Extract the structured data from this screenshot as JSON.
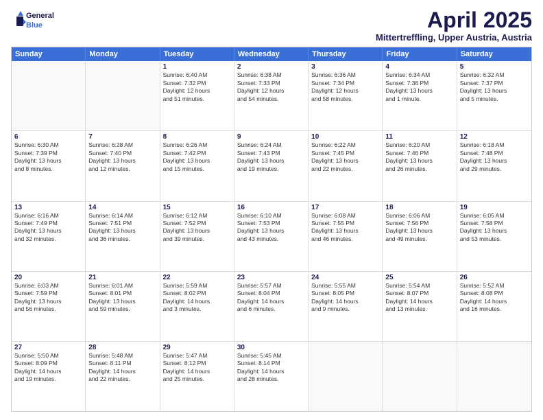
{
  "logo": {
    "line1": "General",
    "line2": "Blue"
  },
  "title": "April 2025",
  "subtitle": "Mittertreffling, Upper Austria, Austria",
  "headers": [
    "Sunday",
    "Monday",
    "Tuesday",
    "Wednesday",
    "Thursday",
    "Friday",
    "Saturday"
  ],
  "weeks": [
    [
      {
        "day": "",
        "info": ""
      },
      {
        "day": "",
        "info": ""
      },
      {
        "day": "1",
        "info": "Sunrise: 6:40 AM\nSunset: 7:32 PM\nDaylight: 12 hours\nand 51 minutes."
      },
      {
        "day": "2",
        "info": "Sunrise: 6:38 AM\nSunset: 7:33 PM\nDaylight: 12 hours\nand 54 minutes."
      },
      {
        "day": "3",
        "info": "Sunrise: 6:36 AM\nSunset: 7:34 PM\nDaylight: 12 hours\nand 58 minutes."
      },
      {
        "day": "4",
        "info": "Sunrise: 6:34 AM\nSunset: 7:36 PM\nDaylight: 13 hours\nand 1 minute."
      },
      {
        "day": "5",
        "info": "Sunrise: 6:32 AM\nSunset: 7:37 PM\nDaylight: 13 hours\nand 5 minutes."
      }
    ],
    [
      {
        "day": "6",
        "info": "Sunrise: 6:30 AM\nSunset: 7:39 PM\nDaylight: 13 hours\nand 8 minutes."
      },
      {
        "day": "7",
        "info": "Sunrise: 6:28 AM\nSunset: 7:40 PM\nDaylight: 13 hours\nand 12 minutes."
      },
      {
        "day": "8",
        "info": "Sunrise: 6:26 AM\nSunset: 7:42 PM\nDaylight: 13 hours\nand 15 minutes."
      },
      {
        "day": "9",
        "info": "Sunrise: 6:24 AM\nSunset: 7:43 PM\nDaylight: 13 hours\nand 19 minutes."
      },
      {
        "day": "10",
        "info": "Sunrise: 6:22 AM\nSunset: 7:45 PM\nDaylight: 13 hours\nand 22 minutes."
      },
      {
        "day": "11",
        "info": "Sunrise: 6:20 AM\nSunset: 7:46 PM\nDaylight: 13 hours\nand 26 minutes."
      },
      {
        "day": "12",
        "info": "Sunrise: 6:18 AM\nSunset: 7:48 PM\nDaylight: 13 hours\nand 29 minutes."
      }
    ],
    [
      {
        "day": "13",
        "info": "Sunrise: 6:16 AM\nSunset: 7:49 PM\nDaylight: 13 hours\nand 32 minutes."
      },
      {
        "day": "14",
        "info": "Sunrise: 6:14 AM\nSunset: 7:51 PM\nDaylight: 13 hours\nand 36 minutes."
      },
      {
        "day": "15",
        "info": "Sunrise: 6:12 AM\nSunset: 7:52 PM\nDaylight: 13 hours\nand 39 minutes."
      },
      {
        "day": "16",
        "info": "Sunrise: 6:10 AM\nSunset: 7:53 PM\nDaylight: 13 hours\nand 43 minutes."
      },
      {
        "day": "17",
        "info": "Sunrise: 6:08 AM\nSunset: 7:55 PM\nDaylight: 13 hours\nand 46 minutes."
      },
      {
        "day": "18",
        "info": "Sunrise: 6:06 AM\nSunset: 7:56 PM\nDaylight: 13 hours\nand 49 minutes."
      },
      {
        "day": "19",
        "info": "Sunrise: 6:05 AM\nSunset: 7:58 PM\nDaylight: 13 hours\nand 53 minutes."
      }
    ],
    [
      {
        "day": "20",
        "info": "Sunrise: 6:03 AM\nSunset: 7:59 PM\nDaylight: 13 hours\nand 56 minutes."
      },
      {
        "day": "21",
        "info": "Sunrise: 6:01 AM\nSunset: 8:01 PM\nDaylight: 13 hours\nand 59 minutes."
      },
      {
        "day": "22",
        "info": "Sunrise: 5:59 AM\nSunset: 8:02 PM\nDaylight: 14 hours\nand 3 minutes."
      },
      {
        "day": "23",
        "info": "Sunrise: 5:57 AM\nSunset: 8:04 PM\nDaylight: 14 hours\nand 6 minutes."
      },
      {
        "day": "24",
        "info": "Sunrise: 5:55 AM\nSunset: 8:05 PM\nDaylight: 14 hours\nand 9 minutes."
      },
      {
        "day": "25",
        "info": "Sunrise: 5:54 AM\nSunset: 8:07 PM\nDaylight: 14 hours\nand 13 minutes."
      },
      {
        "day": "26",
        "info": "Sunrise: 5:52 AM\nSunset: 8:08 PM\nDaylight: 14 hours\nand 16 minutes."
      }
    ],
    [
      {
        "day": "27",
        "info": "Sunrise: 5:50 AM\nSunset: 8:09 PM\nDaylight: 14 hours\nand 19 minutes."
      },
      {
        "day": "28",
        "info": "Sunrise: 5:48 AM\nSunset: 8:11 PM\nDaylight: 14 hours\nand 22 minutes."
      },
      {
        "day": "29",
        "info": "Sunrise: 5:47 AM\nSunset: 8:12 PM\nDaylight: 14 hours\nand 25 minutes."
      },
      {
        "day": "30",
        "info": "Sunrise: 5:45 AM\nSunset: 8:14 PM\nDaylight: 14 hours\nand 28 minutes."
      },
      {
        "day": "",
        "info": ""
      },
      {
        "day": "",
        "info": ""
      },
      {
        "day": "",
        "info": ""
      }
    ]
  ]
}
